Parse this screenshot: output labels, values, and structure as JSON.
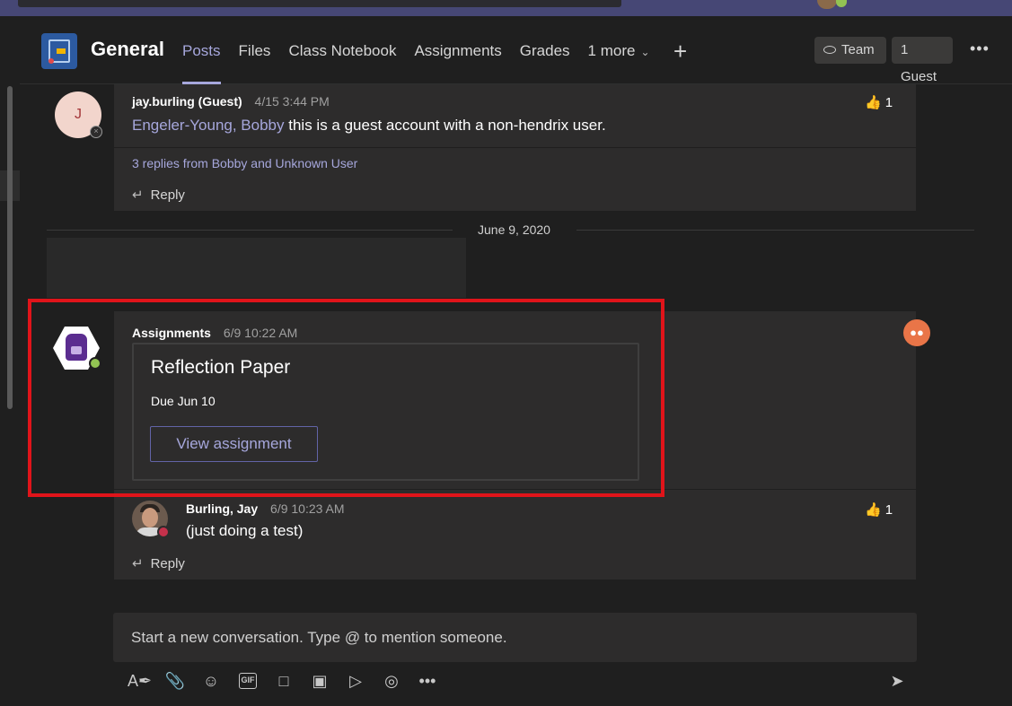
{
  "header": {
    "channel_title": "General",
    "tabs": [
      {
        "label": "Posts",
        "active": true
      },
      {
        "label": "Files"
      },
      {
        "label": "Class Notebook"
      },
      {
        "label": "Assignments"
      },
      {
        "label": "Grades"
      },
      {
        "label": "1 more"
      }
    ],
    "team_pill": "Team",
    "guest_pill": "1 Guest"
  },
  "thread1": {
    "avatar_initial": "J",
    "author": "jay.burling (Guest)",
    "time": "4/15 3:44 PM",
    "mention": "Engeler-Young, Bobby",
    "message": " this is a guest account with a non-hendrix user.",
    "reaction_count": "1",
    "replies_summary": "3 replies from Bobby and Unknown User",
    "reply_label": "Reply"
  },
  "date_separator": "June 9, 2020",
  "thread2": {
    "author": "Assignments",
    "time": "6/9 10:22 AM",
    "card_title": "Reflection Paper",
    "card_due": "Due Jun 10",
    "view_button": "View assignment",
    "reply": {
      "author": "Burling, Jay",
      "time": "6/9 10:23 AM",
      "message": "(just doing a test)",
      "reaction_count": "1"
    },
    "reply_label": "Reply"
  },
  "composer": {
    "placeholder": "Start a new conversation. Type @ to mention someone."
  },
  "colors": {
    "accent": "#a6a7dc",
    "highlight": "#e0141a",
    "app_bar": "#464775"
  }
}
